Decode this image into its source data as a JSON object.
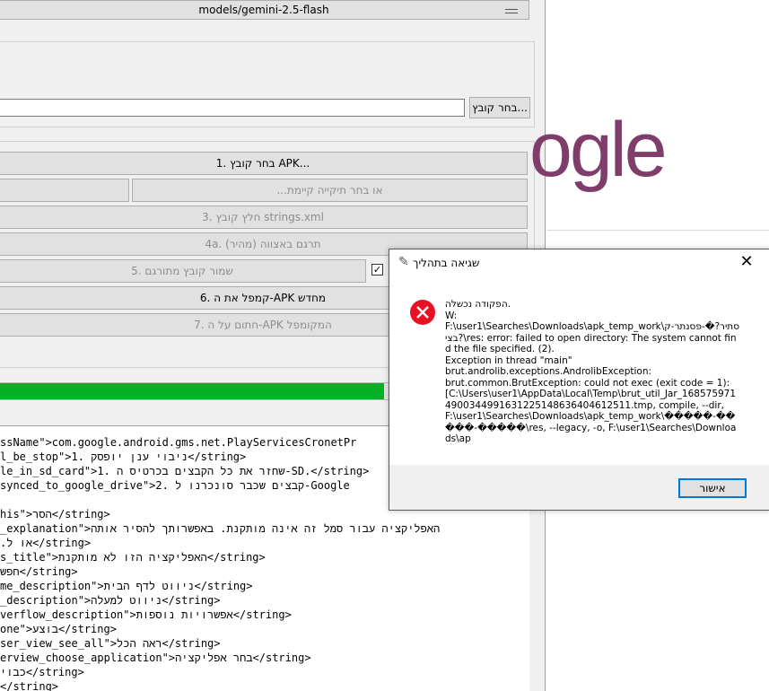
{
  "app": {
    "model_select": "models/gemini-2.5-flash",
    "file_path_value": "",
    "choose_file_btn": "בחר קובץ...",
    "buttons": {
      "apk": "1. בחר קובץ APK...",
      "folder": "...או בחר תיקייה קיימת",
      "extract": "3. חלץ קובץ strings.xml",
      "translate": "4a. תרגם באצווה (מהיר)",
      "save": "5. שמור קובץ מתורגם",
      "rebuild": "6. קמפל את ה-APK מחדש",
      "sign": "7. חתום על ה-APK המקומפל"
    },
    "progress_percent": 72
  },
  "code_lines": [
    "ssName\">com.google.android.gms.net.PlayServicesCronetPr",
    "l_be_stop\">1. ‏ניבוי ענן יופסק</string>",
    "le_in_sd_card\">1. ‏שחזר את כל הקבצים בכרטיס ה-SD.</string>",
    "synced_to_google_drive\">2. ‏קבצים שכבר סונכרנו ל-Google",
    "",
    "his\">הסר</string>",
    "_explanation\">האפליקציה עבור סמל זה אינה מותקנת. באפשרותך להסיר אותה",
    ".או ל</string>",
    "s_title\">האפליקציה הזו לא מותקנת</string>",
    "חפש</string>",
    "me_description\">ניווט לדף הבית</string>",
    "_description\">ניווט למעלה</string>",
    "verflow_description\">אפשרויות נוספות</string>",
    "one\">בוצע</string>",
    "ser_view_see_all\">ראה הכל</string>",
    "erview_choose_application\">בחר אפליקציה</string>",
    "כבוי</string>",
    "</string>"
  ],
  "background": {
    "logo_text": "ogle"
  },
  "dialog": {
    "title": "שגיאה בתהליך",
    "message": [
      "הפקודה נכשלה.",
      "W:",
      "F:\\user1\\Searches\\Downloads\\apk_temp_work\\סתיר?�-פסנתר-קבצי?\\res: error: failed to open directory: The system cannot find the file specified. (2).",
      "Exception in thread \"main\"",
      "brut.androlib.exceptions.AndrolibException:",
      "brut.common.BrutException: could not exec (exit code = 1):",
      "[C:\\Users\\user1\\AppData\\Local\\Temp\\brut_util_Jar_1685759714900344991631225148636404612511.tmp, compile, --dir, F:\\user1\\Searches\\Downloads\\apk_temp_work\\�����-�����-�����\\res, --legacy, -o, F:\\user1\\Searches\\Downloads\\ap"
    ],
    "ok_button": "אישור"
  }
}
